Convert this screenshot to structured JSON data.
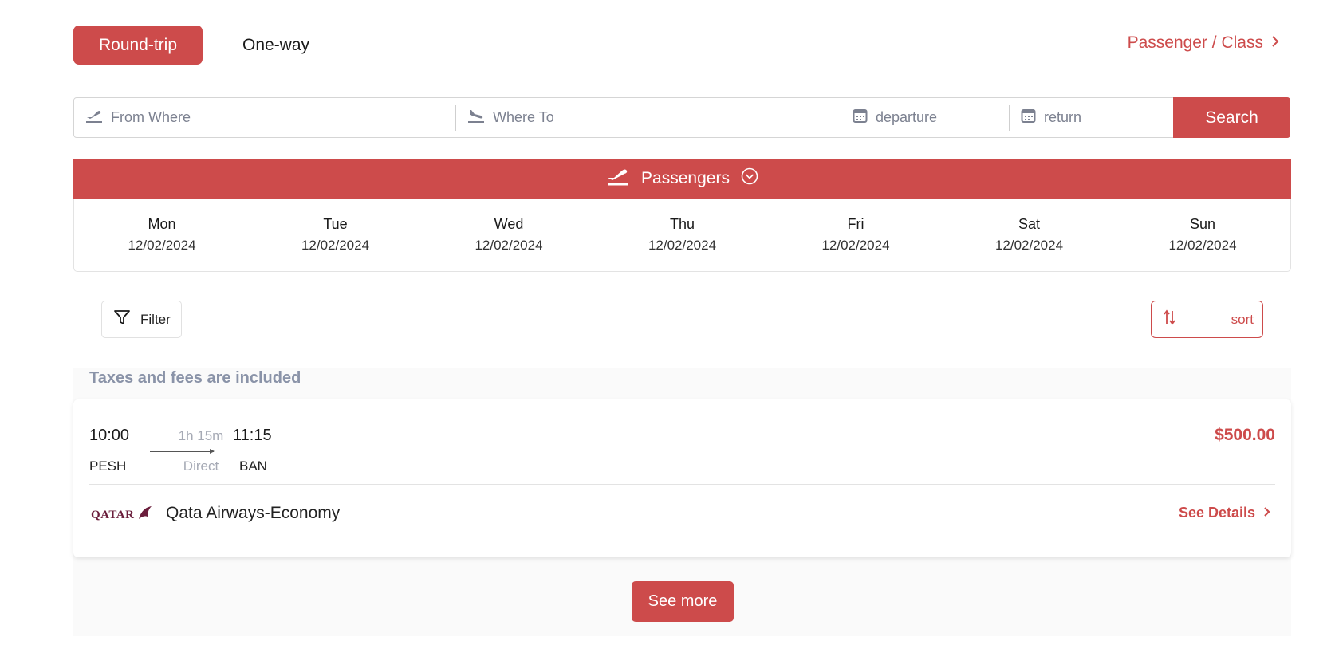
{
  "trip_type": {
    "round_trip_label": "Round-trip",
    "one_way_label": "One-way",
    "selected": "Round-trip"
  },
  "passenger_class_link": "Passenger / Class",
  "search": {
    "from_placeholder": "From Where",
    "to_placeholder": "Where To",
    "departure_placeholder": "departure",
    "return_placeholder": "return",
    "search_label": "Search"
  },
  "passengers_banner": {
    "label": "Passengers"
  },
  "days": [
    {
      "name": "Mon",
      "date": "12/02/2024"
    },
    {
      "name": "Tue",
      "date": "12/02/2024"
    },
    {
      "name": "Wed",
      "date": "12/02/2024"
    },
    {
      "name": "Thu",
      "date": "12/02/2024"
    },
    {
      "name": "Fri",
      "date": "12/02/2024"
    },
    {
      "name": "Sat",
      "date": "12/02/2024"
    },
    {
      "name": "Sun",
      "date": "12/02/2024"
    }
  ],
  "filter_label": "Filter",
  "sort_label": "sort",
  "results": {
    "taxes_note": "Taxes and fees are included",
    "flight": {
      "departure_time": "10:00",
      "departure_code": "PESH",
      "duration": "1h 15m",
      "stops": "Direct",
      "arrival_time": "11:15",
      "arrival_code": "BAN",
      "price": "$500.00",
      "airline": "Qata Airways-Economy",
      "logo_text": "QATAR",
      "details_label": "See Details"
    },
    "see_more_label": "See more"
  },
  "colors": {
    "accent": "#cd4b4b",
    "muted_text": "#8a93a8"
  },
  "icons": {
    "from": "plane-takeoff-icon",
    "to": "plane-landing-icon",
    "date": "calendar-icon",
    "filter": "funnel-icon",
    "sort": "sort-arrows-icon",
    "chevron": "chevron-right-icon",
    "dropdown": "chevron-down-circle-icon"
  }
}
